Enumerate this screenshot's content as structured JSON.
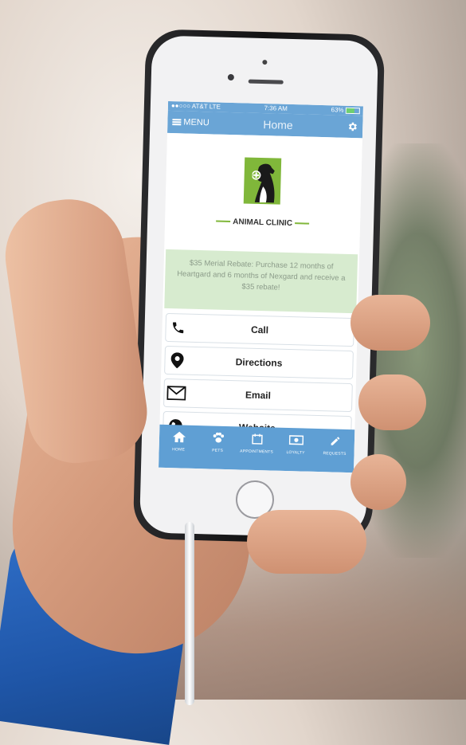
{
  "status_bar": {
    "carrier": "●●○○○ AT&T  LTE",
    "time": "7:36 AM",
    "battery": "63%",
    "battery_level": 0.63
  },
  "nav": {
    "menu_label": "MENU",
    "title": "Home"
  },
  "logo": {
    "text": "ANIMAL CLINIC",
    "brand_color": "#80b73a"
  },
  "promo": {
    "text": "$35 Merial Rebate: Purchase 12 months of Heartgard and 6 months of Nexgard and receive a $35 rebate!"
  },
  "actions": [
    {
      "label": "Call",
      "icon": "phone-icon"
    },
    {
      "label": "Directions",
      "icon": "map-pin-icon"
    },
    {
      "label": "Email",
      "icon": "envelope-icon"
    },
    {
      "label": "Website",
      "icon": "globe-icon"
    }
  ],
  "tabs": [
    {
      "label": "HOME",
      "icon": "home-icon"
    },
    {
      "label": "PETS",
      "icon": "paw-icon"
    },
    {
      "label": "APPOINTMENTS",
      "icon": "calendar-icon"
    },
    {
      "label": "LOYALTY",
      "icon": "money-icon"
    },
    {
      "label": "REQUESTS",
      "icon": "pencil-icon"
    }
  ],
  "colors": {
    "header": "#6aa5d6",
    "tab_bar": "#5f9fd4",
    "promo_bg": "#d7ebcf"
  }
}
